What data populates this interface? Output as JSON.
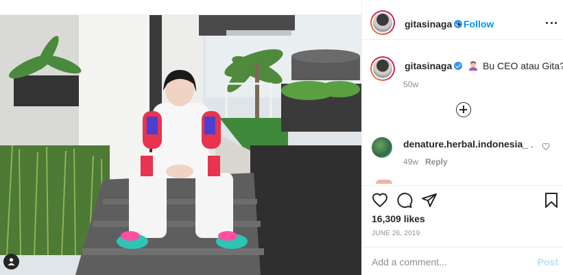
{
  "post": {
    "username": "gitasinaga",
    "follow_label": "Follow",
    "separator": "•",
    "caption_text": "Bu CEO atau Gita?",
    "caption_emoji": "woman-tipping-hand-emoji",
    "time_ago": "50w"
  },
  "comments": [
    {
      "username": "denature.herbal.indonesia_",
      "text": ".",
      "time": "49w",
      "reply_label": "Reply"
    }
  ],
  "stats": {
    "likes": "16,309 likes",
    "date": "JUNE 26, 2019"
  },
  "comment_form": {
    "placeholder": "Add a comment...",
    "post_label": "Post"
  },
  "icons": {
    "more": "more-horizontal-icon",
    "load_more": "plus-circle-icon",
    "like": "heart-icon",
    "comment": "comment-bubble-icon",
    "share": "paper-plane-icon",
    "save": "bookmark-icon",
    "tag": "user-tag-icon"
  },
  "colors": {
    "link": "#0095f6",
    "post_disabled": "#b2dffc",
    "muted": "#8e8e8e",
    "text": "#262626"
  }
}
